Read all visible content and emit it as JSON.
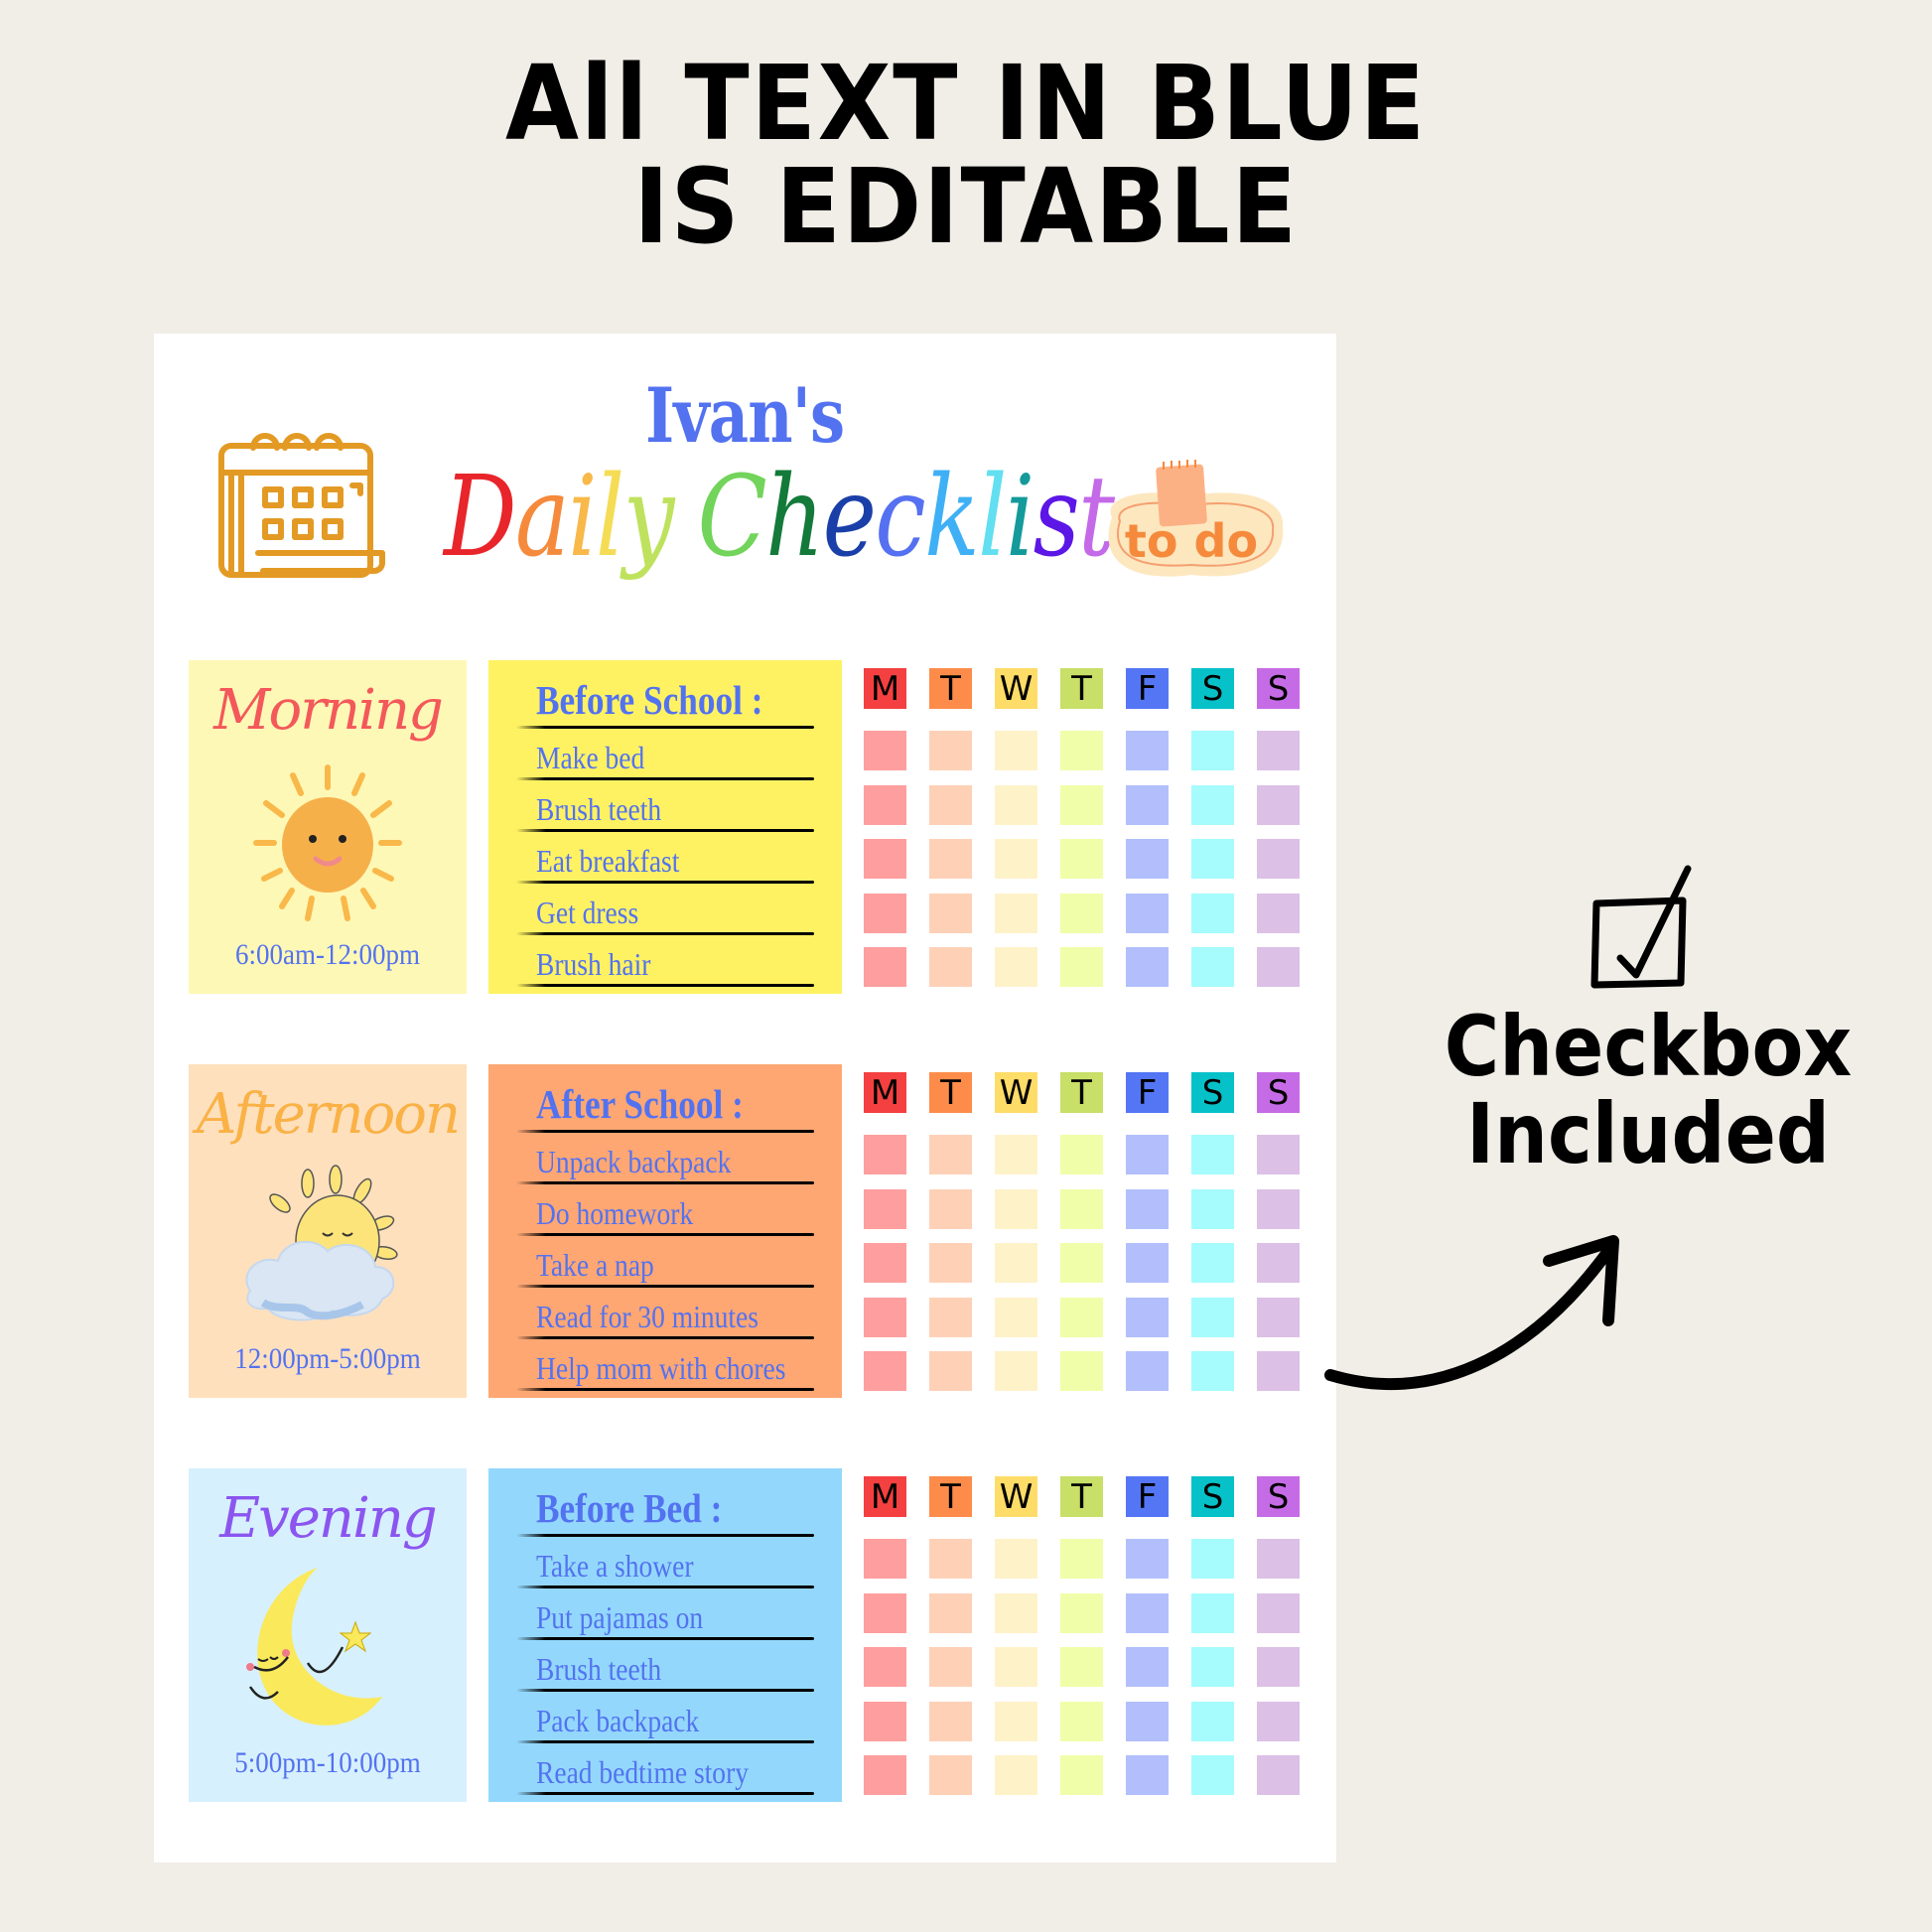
{
  "headline": {
    "line1": "All TEXT IN BLUE",
    "line2": "IS EDITABLE"
  },
  "checklist_page": {
    "owner": "Ivan's",
    "title_letters": [
      {
        "ch": "D",
        "color": "#e8252a"
      },
      {
        "ch": "a",
        "color": "#f58a3c"
      },
      {
        "ch": "i",
        "color": "#f9b84a"
      },
      {
        "ch": "l",
        "color": "#f5dc55"
      },
      {
        "ch": "y",
        "color": "#bfe25e"
      },
      {
        "ch": " ",
        "color": "#ffffff"
      },
      {
        "ch": "C",
        "color": "#72d45a"
      },
      {
        "ch": "h",
        "color": "#137a3a"
      },
      {
        "ch": "e",
        "color": "#1a3fa8"
      },
      {
        "ch": "c",
        "color": "#5570f0"
      },
      {
        "ch": "k",
        "color": "#3fb0f5"
      },
      {
        "ch": "l",
        "color": "#62dff0"
      },
      {
        "ch": "i",
        "color": "#149a9a"
      },
      {
        "ch": "s",
        "color": "#5c16e6"
      },
      {
        "ch": "t",
        "color": "#c46ae8"
      }
    ],
    "title": "Daily Checklist",
    "calendar_icon": "calendar-icon",
    "todo_badge": "to do",
    "days": [
      "M",
      "T",
      "W",
      "T",
      "F",
      "S",
      "S"
    ],
    "day_colors": [
      "#f44040",
      "#fd8c4a",
      "#fedc68",
      "#c8df68",
      "#5476f5",
      "#07c1c9",
      "#c66be6"
    ],
    "box_colors": [
      "#fe9e9e",
      "#fed1b7",
      "#fef2c9",
      "#f0feaa",
      "#b2bffc",
      "#a6fbfc",
      "#dcc0e6"
    ],
    "sections": [
      {
        "period": "Morning",
        "period_color": "#f3585a",
        "time": "6:00am-12:00pm",
        "panel_bg": "#fef8b6",
        "list_bg": "#fef262",
        "art": "sun-icon",
        "list_title": "Before School :",
        "items": [
          "Make bed",
          "Brush teeth",
          "Eat breakfast",
          "Get dress",
          "Brush hair"
        ]
      },
      {
        "period": "Afternoon",
        "period_color": "#fab146",
        "time": "12:00pm-5:00pm",
        "panel_bg": "#fee0bd",
        "list_bg": "#fea773",
        "art": "sun-behind-cloud-icon",
        "list_title": "After School :",
        "items": [
          "Unpack backpack",
          "Do homework",
          "Take a nap",
          "Read for 30 minutes",
          "Help mom with chores"
        ]
      },
      {
        "period": "Evening",
        "period_color": "#8b55f0",
        "time": "5:00pm-10:00pm",
        "panel_bg": "#d7f0fd",
        "list_bg": "#93d8fc",
        "art": "crescent-moon-icon",
        "list_title": "Before Bed :",
        "items": [
          "Take a shower",
          "Put pajamas on",
          "Brush teeth",
          "Pack backpack",
          "Read bedtime story"
        ]
      }
    ]
  },
  "callout": {
    "icon": "checked-box-icon",
    "line1": "Checkbox",
    "line2": "Included",
    "arrow": "curved-arrow-icon"
  }
}
